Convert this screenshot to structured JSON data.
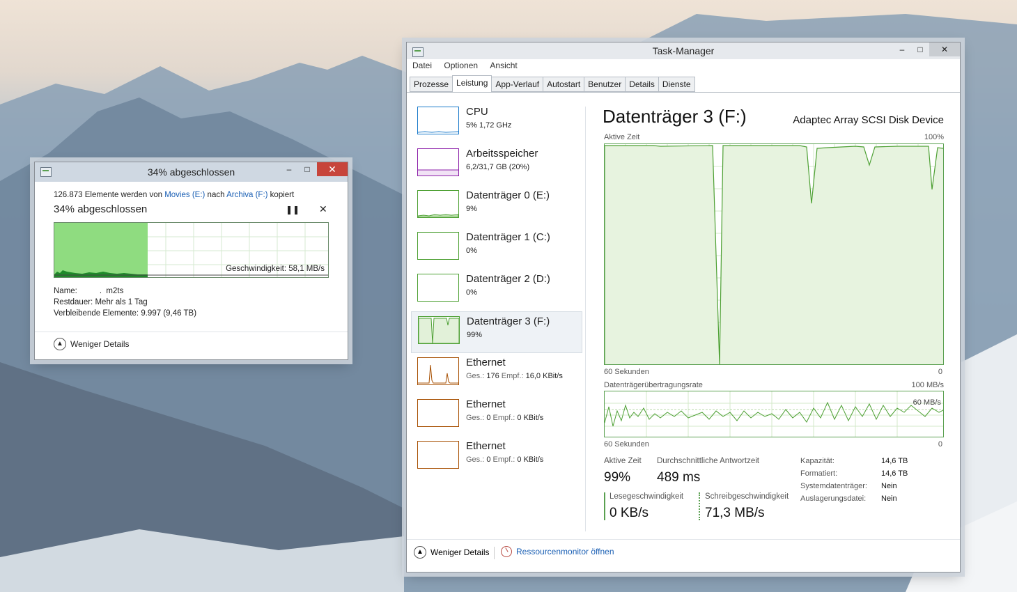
{
  "copy_dialog": {
    "title": "34% abgeschlossen",
    "line_count": "126.873 Elemente werden von ",
    "source": "Movies (E:)",
    "to": " nach ",
    "destination": "Archiva (F:)",
    "verb": " kopiert",
    "percent_text": "34% abgeschlossen",
    "progress_fraction": 0.34,
    "speed_text": "Geschwindigkeit: 58,1 MB/s",
    "name_label": "Name:",
    "name_value": "         .  m2ts",
    "rest_label": "Restdauer:",
    "rest_value": "Mehr als 1 Tag",
    "remaining_label": "Verbleibende Elemente:",
    "remaining_value": "9.997 (9,46 TB)",
    "less_details": "Weniger Details",
    "pause_icon": "pause-icon",
    "close_icon": "close-icon"
  },
  "task_manager": {
    "title": "Task-Manager",
    "menu": [
      "Datei",
      "Optionen",
      "Ansicht"
    ],
    "tabs": [
      "Prozesse",
      "Leistung",
      "App-Verlauf",
      "Autostart",
      "Benutzer",
      "Details",
      "Dienste"
    ],
    "active_tab": "Leistung",
    "sidebar": [
      {
        "title": "CPU",
        "sub": "5% 1,72 GHz",
        "color": "#1979ca"
      },
      {
        "title": "Arbeitsspeicher",
        "sub": "6,2/31,7 GB (20%)",
        "color": "#8b1ea8"
      },
      {
        "title": "Datenträger 0 (E:)",
        "sub": "9%",
        "color": "#4da033"
      },
      {
        "title": "Datenträger 1 (C:)",
        "sub": "0%",
        "color": "#4da033"
      },
      {
        "title": "Datenträger 2 (D:)",
        "sub": "0%",
        "color": "#4da033"
      },
      {
        "title": "Datenträger 3 (F:)",
        "sub": "99%",
        "color": "#4da033"
      },
      {
        "title": "Ethernet",
        "sub_ges_label": "Ges.:",
        "sub_ges": "176",
        "sub_empf_label": "Empf.:",
        "sub_empf": "16,0 KBit/s",
        "color": "#a74f01"
      },
      {
        "title": "Ethernet",
        "sub_ges_label": "Ges.:",
        "sub_ges": "0",
        "sub_empf_label": "Empf.:",
        "sub_empf": "0 KBit/s",
        "color": "#a74f01"
      },
      {
        "title": "Ethernet",
        "sub_ges_label": "Ges.:",
        "sub_ges": "0",
        "sub_empf_label": "Empf.:",
        "sub_empf": "0 KBit/s",
        "color": "#a74f01"
      }
    ],
    "selected_index": 5,
    "main": {
      "title": "Datenträger 3 (F:)",
      "model": "Adaptec Array SCSI Disk Device",
      "active_time_label": "Aktive Zeit",
      "active_max": "100%",
      "sixty_sec": "60 Sekunden",
      "zero": "0",
      "transfer_label": "Datenträgerübertragungsrate",
      "transfer_max": "100 MB/s",
      "transfer_mid": "60 MB/s",
      "active_time_value": "99%",
      "avg_response_label": "Durchschnittliche Antwortzeit",
      "avg_response_value": "489 ms",
      "read_label": "Lesegeschwindigkeit",
      "read_value": "0 KB/s",
      "write_label": "Schreibgeschwindigkeit",
      "write_value": "71,3 MB/s",
      "props": [
        {
          "label": "Kapazität:",
          "value": "14,6 TB"
        },
        {
          "label": "Formatiert:",
          "value": "14,6 TB"
        },
        {
          "label": "Systemdatenträger:",
          "value": "Nein"
        },
        {
          "label": "Auslagerungsdatei:",
          "value": "Nein"
        }
      ]
    },
    "footer": {
      "less_details": "Weniger Details",
      "resource_monitor": "Ressourcenmonitor öffnen"
    }
  },
  "colors": {
    "disk_green": "#4da033",
    "disk_fill": "#e7f3df",
    "copy_fill": "#8fdc80",
    "close_red": "#c7453b",
    "link_blue": "#1a5fb4"
  }
}
